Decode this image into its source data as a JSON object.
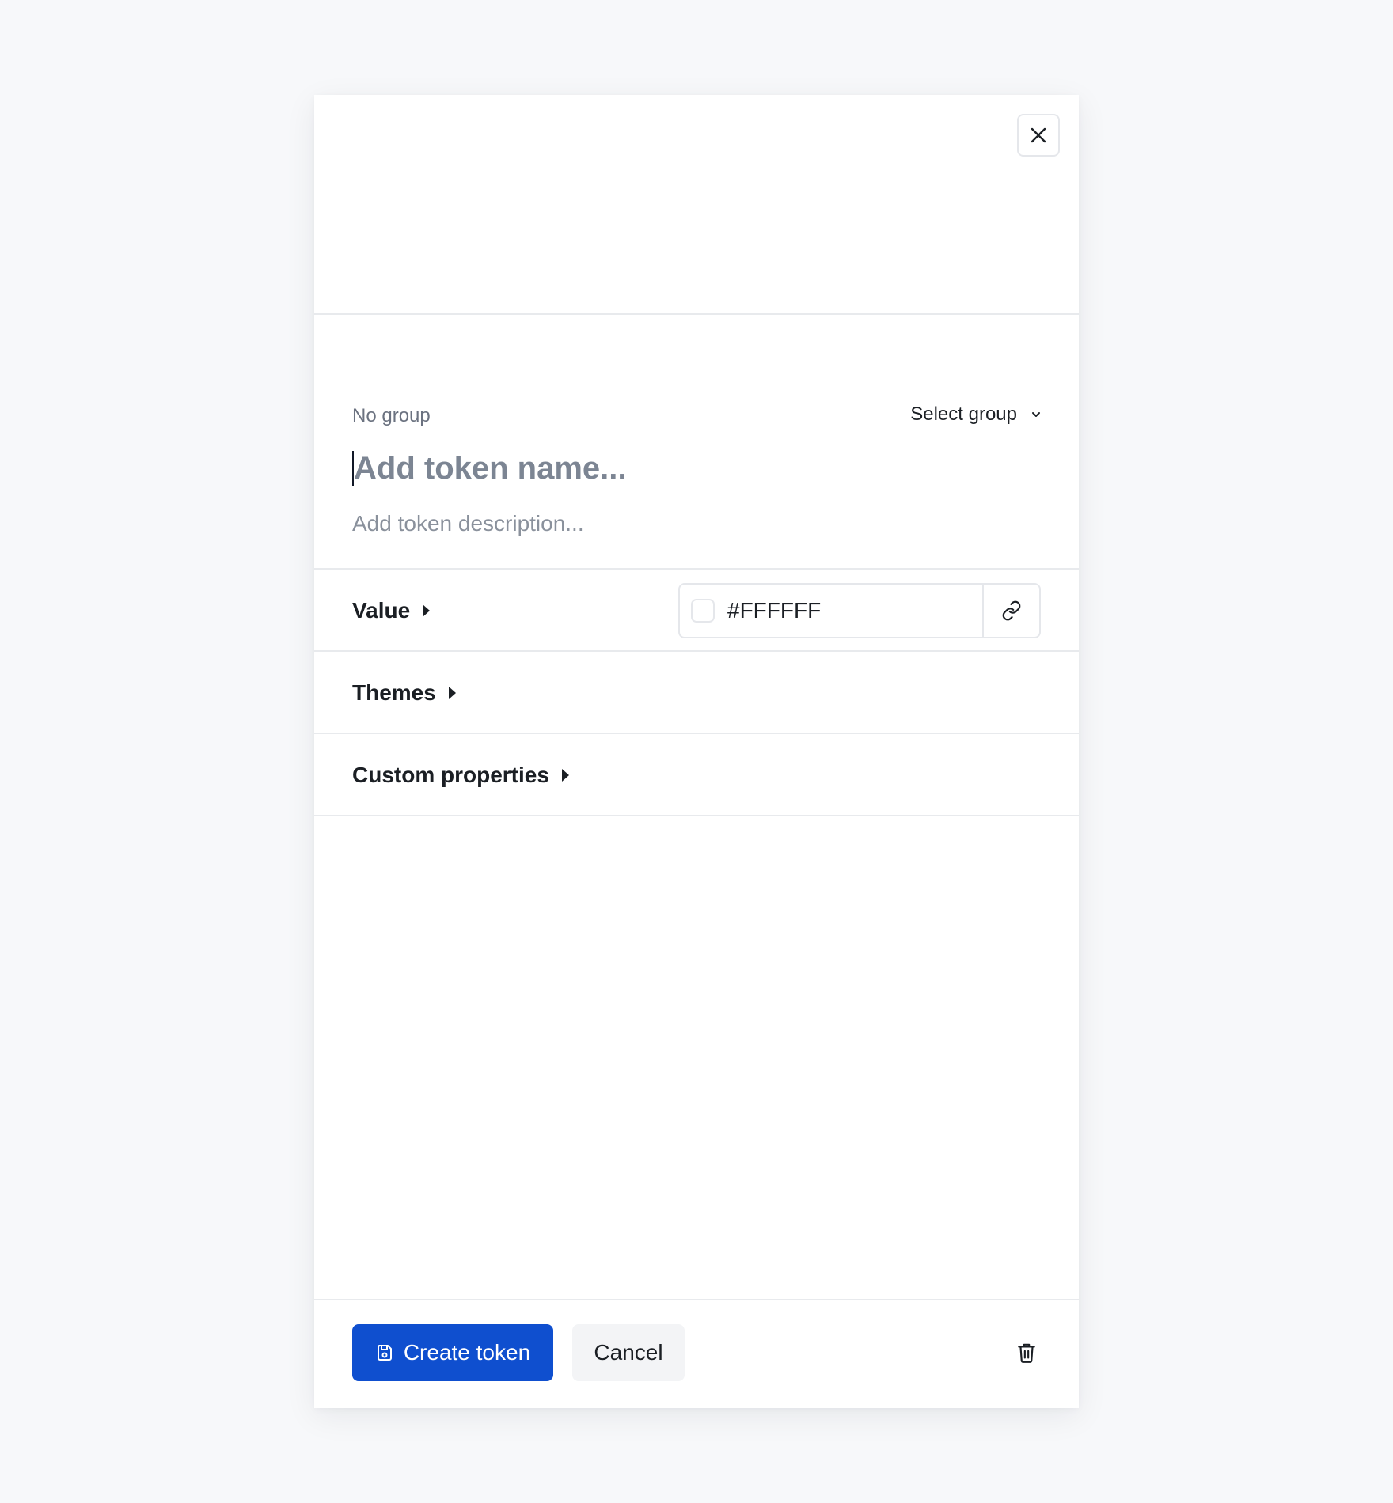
{
  "dialog": {
    "close_icon": "close-icon"
  },
  "meta": {
    "group_label": "No group",
    "select_group_label": "Select group",
    "name_placeholder": "Add token name...",
    "description_placeholder": "Add token description..."
  },
  "sections": {
    "value_label": "Value",
    "themes_label": "Themes",
    "custom_properties_label": "Custom properties"
  },
  "value_field": {
    "value": "#FFFFFF",
    "swatch_color": "#FFFFFF",
    "link_icon": "link-icon"
  },
  "footer": {
    "create_label": "Create token",
    "create_icon": "save-icon",
    "cancel_label": "Cancel",
    "delete_icon": "trash-icon"
  },
  "colors": {
    "primary": "#0F4FCF",
    "background": "#F7F8FA",
    "border": "#E5E7EB",
    "muted_text": "#6B7280"
  }
}
